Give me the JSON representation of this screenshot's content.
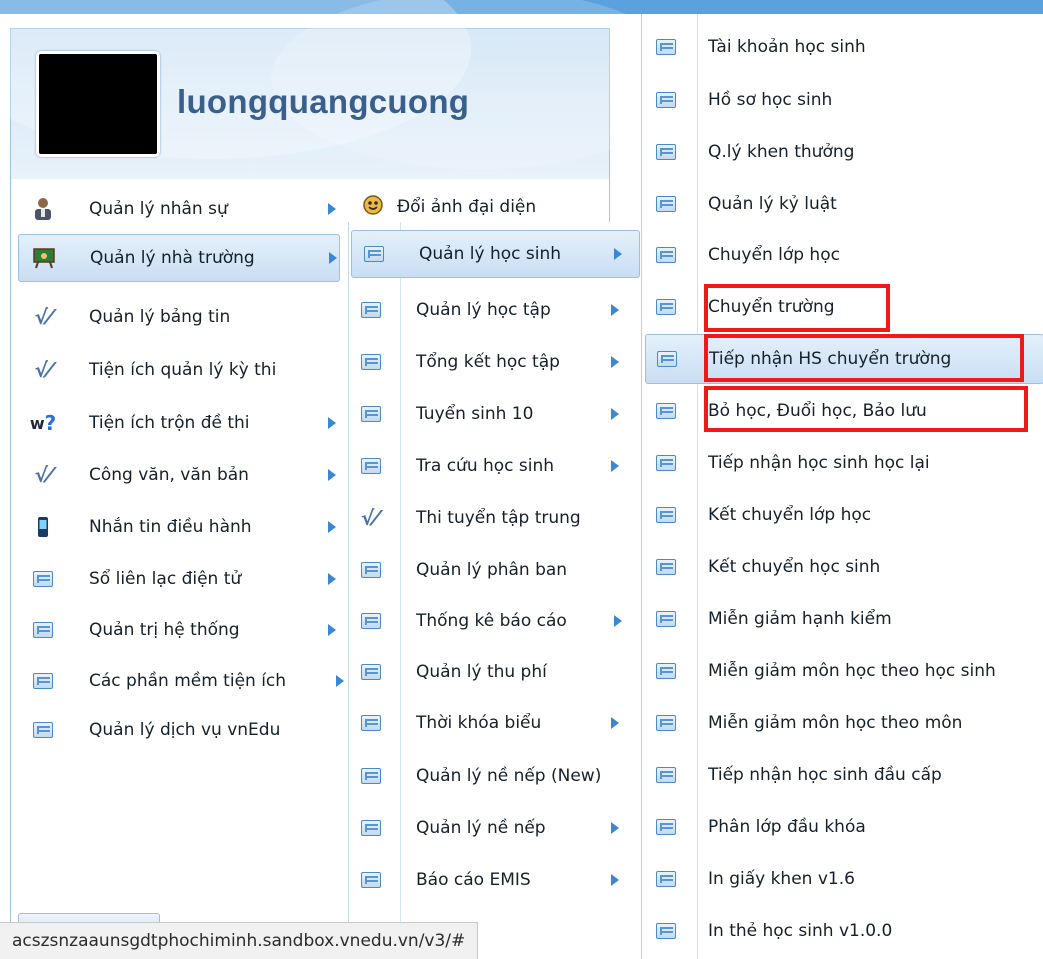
{
  "user": {
    "name": "luongquangcuong"
  },
  "main_menu": {
    "items": [
      {
        "label": "Quản lý nhân sự",
        "icon": "user-admin-icon",
        "submenu": true
      },
      {
        "label": "Quản lý nhà trường",
        "icon": "school-board-icon",
        "submenu": true,
        "selected": true
      },
      {
        "label": "Quản lý bảng tin",
        "icon": "check-doc-icon",
        "submenu": false
      },
      {
        "label": "Tiện ích quản lý kỳ thi",
        "icon": "check-doc-icon",
        "submenu": false
      },
      {
        "label": "Tiện ích trộn đề thi",
        "icon": "w-question-icon",
        "submenu": true
      },
      {
        "label": "Công văn, văn bản",
        "icon": "check-doc-icon",
        "submenu": true
      },
      {
        "label": "Nhắn tin điều hành",
        "icon": "phone-icon",
        "submenu": true
      },
      {
        "label": "Sổ liên lạc điện tử",
        "icon": "list-icon",
        "submenu": true
      },
      {
        "label": "Quản trị hệ thống",
        "icon": "list-icon",
        "submenu": true
      },
      {
        "label": "Các phần mềm tiện ích",
        "icon": "list-icon",
        "submenu": true
      },
      {
        "label": "Quản lý dịch vụ vnEdu",
        "icon": "list-icon",
        "submenu": false
      }
    ]
  },
  "change_avatar": {
    "label": "Đổi ảnh đại diện"
  },
  "school_menu": {
    "items": [
      {
        "label": "Quản lý học sinh",
        "submenu": true,
        "selected": true
      },
      {
        "label": "Quản lý học tập",
        "submenu": true
      },
      {
        "label": "Tổng kết học tập",
        "submenu": true
      },
      {
        "label": "Tuyển sinh 10",
        "submenu": true
      },
      {
        "label": "Tra cứu học sinh",
        "submenu": true
      },
      {
        "label": "Thi tuyển tập trung",
        "submenu": false,
        "icon": "check-doc-icon"
      },
      {
        "label": "Quản lý phân ban",
        "submenu": false
      },
      {
        "label": "Thống kê báo cáo",
        "submenu": true
      },
      {
        "label": "Quản lý thu phí",
        "submenu": false
      },
      {
        "label": "Thời khóa biểu",
        "submenu": true
      },
      {
        "label": "Quản lý nề nếp (New)",
        "submenu": false
      },
      {
        "label": "Quản lý nề nếp",
        "submenu": true
      },
      {
        "label": "Báo cáo EMIS",
        "submenu": true
      }
    ]
  },
  "student_menu": {
    "items": [
      {
        "label": "Tài khoản học sinh"
      },
      {
        "label": "Hồ sơ học sinh"
      },
      {
        "label": "Q.lý khen thưởng"
      },
      {
        "label": "Quản lý kỷ luật"
      },
      {
        "label": "Chuyển lớp học"
      },
      {
        "label": "Chuyển trường",
        "highlighted": true
      },
      {
        "label": "Tiếp nhận HS chuyển trường",
        "selected": true,
        "highlighted": true
      },
      {
        "label": "Bỏ học, Đuổi học, Bảo lưu",
        "highlighted": true
      },
      {
        "label": "Tiếp nhận học sinh học lại"
      },
      {
        "label": "Kết chuyển lớp học"
      },
      {
        "label": "Kết chuyển học sinh"
      },
      {
        "label": "Miễn giảm hạnh kiểm"
      },
      {
        "label": "Miễn giảm môn học theo học sinh"
      },
      {
        "label": "Miễn giảm môn học theo môn"
      },
      {
        "label": "Tiếp nhận học sinh đầu cấp"
      },
      {
        "label": "Phân lớp đầu khóa"
      },
      {
        "label": "In giấy khen v1.6"
      },
      {
        "label": "In thẻ học sinh v1.0.0"
      }
    ]
  },
  "status_bar": {
    "url": "acszsnzaaunsgdtphochiminh.sandbox.vnedu.vn/v3/#"
  },
  "colors": {
    "accent": "#3c86d6",
    "highlight": "#ee1a1a",
    "selected_bg": "#c9def3"
  }
}
